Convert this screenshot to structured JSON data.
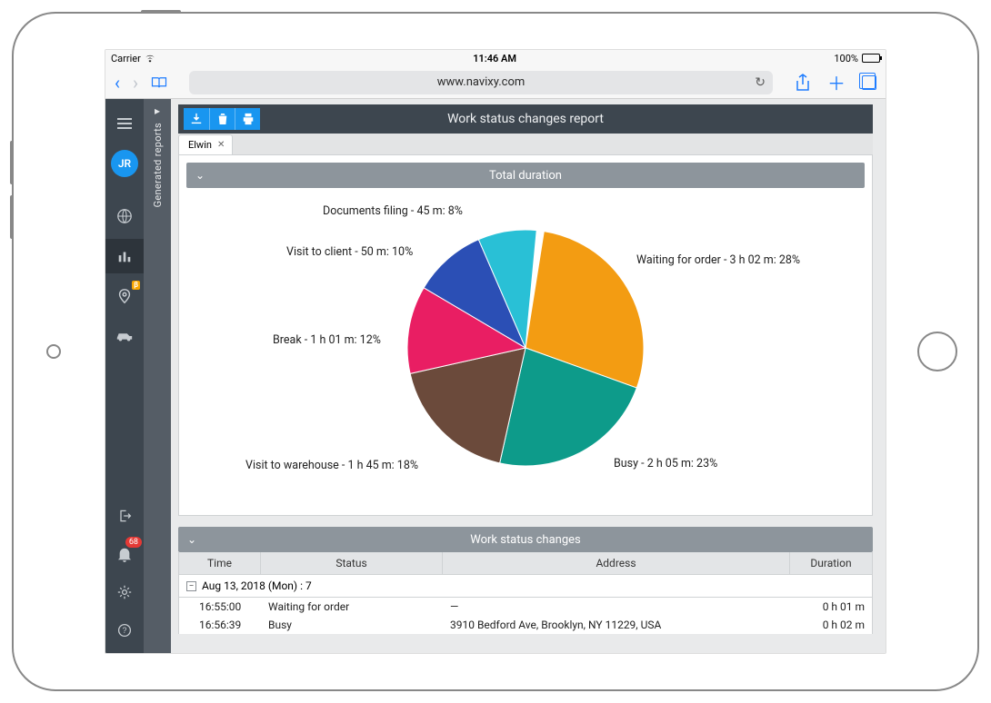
{
  "statusbar": {
    "carrier": "Carrier",
    "time": "11:46 AM",
    "battery": "100%"
  },
  "safari": {
    "url": "www.navixy.com"
  },
  "sidebar": {
    "avatar": "JR",
    "beta_label": "β",
    "notifications": "68"
  },
  "side_panel": {
    "label": "Generated reports"
  },
  "toolbar": {
    "title": "Work status changes report"
  },
  "file_tab": {
    "name": "Elwin"
  },
  "section1": {
    "title": "Total duration"
  },
  "section2": {
    "title": "Work status changes"
  },
  "chart_data": {
    "type": "pie",
    "title": "Total duration",
    "series": [
      {
        "name": "Waiting for order",
        "duration": "3 h 02 m",
        "pct": 28,
        "color": "#f39c12",
        "label": "Waiting for order - 3 h 02 m: 28%"
      },
      {
        "name": "Busy",
        "duration": "2 h 05 m",
        "pct": 23,
        "color": "#0d9b8a",
        "label": "Busy - 2 h 05 m: 23%"
      },
      {
        "name": "Visit to warehouse",
        "duration": "1 h 45 m",
        "pct": 18,
        "color": "#6b4a3b",
        "label": "Visit to warehouse - 1 h 45 m: 18%"
      },
      {
        "name": "Break",
        "duration": "1 h 01 m",
        "pct": 12,
        "color": "#e91e63",
        "label": "Break - 1 h 01 m: 12%"
      },
      {
        "name": "Visit to client",
        "duration": "50 m",
        "pct": 10,
        "color": "#2b4fb5",
        "label": "Visit to client - 50 m: 10%"
      },
      {
        "name": "Documents filing",
        "duration": "45 m",
        "pct": 8,
        "color": "#29c0d6",
        "label": "Documents filing - 45 m: 8%"
      }
    ]
  },
  "table": {
    "headers": {
      "time": "Time",
      "status": "Status",
      "address": "Address",
      "duration": "Duration"
    },
    "group": "Aug 13, 2018 (Mon) : 7",
    "rows": [
      {
        "time": "16:55:00",
        "status": "Waiting for order",
        "address": "—",
        "duration": "0 h 01 m"
      },
      {
        "time": "16:56:39",
        "status": "Busy",
        "address": "3910 Bedford Ave, Brooklyn, NY 11229, USA",
        "duration": "0 h 02 m"
      }
    ]
  }
}
